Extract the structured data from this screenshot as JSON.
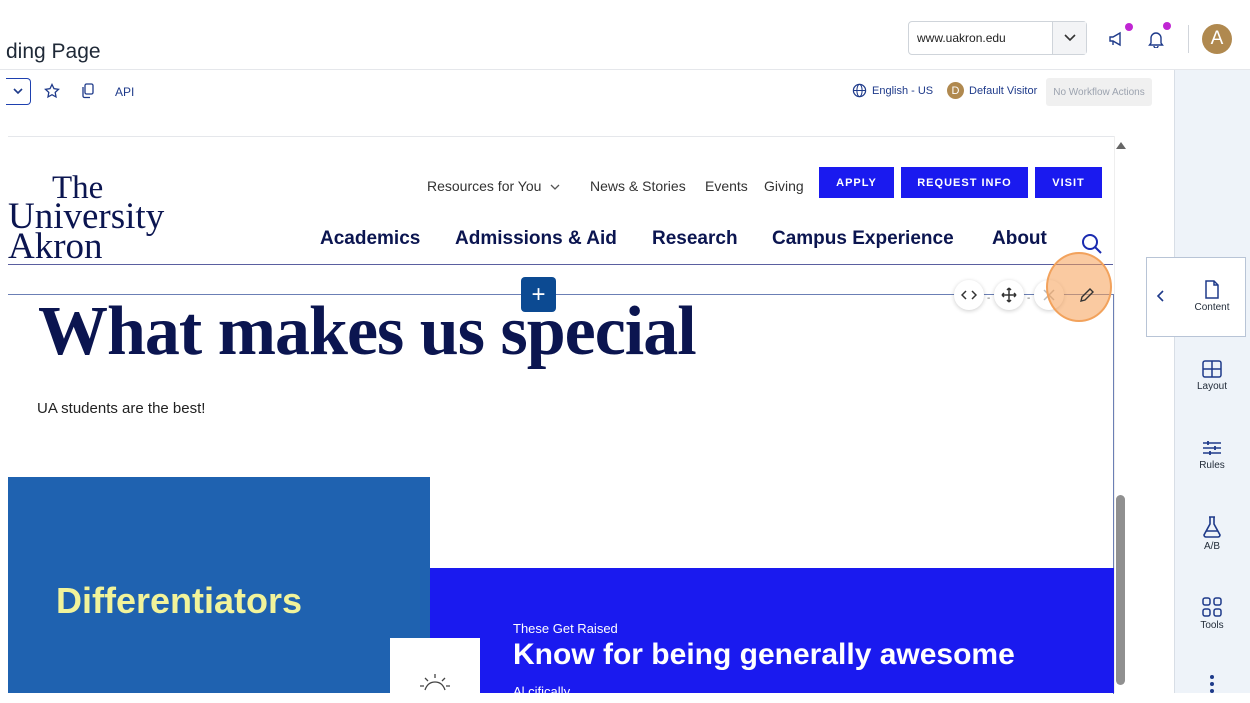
{
  "header": {
    "page_title": "ding Page",
    "domain_select": "www.uakron.edu",
    "avatar_letter": "A"
  },
  "toolbar": {
    "api_label": "API",
    "language": "English - US",
    "visitor_badge": "D",
    "visitor": "Default Visitor",
    "workflow": "No Workflow Actions"
  },
  "site": {
    "logo": {
      "line1": "The",
      "line2": "University",
      "line3": "Akron"
    },
    "utility_nav": [
      "Resources for You",
      "News & Stories",
      "Events",
      "Giving"
    ],
    "cta": [
      "APPLY",
      "REQUEST INFO",
      "VISIT"
    ],
    "main_nav": [
      "Academics",
      "Admissions & Aid",
      "Research",
      "Campus Experience",
      "About"
    ]
  },
  "content": {
    "hero_title": "What makes us special",
    "hero_sub": "UA students are the best!",
    "differentiators": "Differentiators",
    "eyebrow": "These Get Raised",
    "know_title": "Know for being generally awesome",
    "know_sub": "Al    cifically"
  },
  "panel": {
    "content": "Content",
    "layout": "Layout",
    "rules": "Rules",
    "ab": "A/B",
    "tools": "Tools"
  },
  "colors": {
    "brand_navy": "#0b1550",
    "cta_blue": "#1a1aef",
    "diff_blue": "#1f62b0",
    "diff_text": "#f1f39a",
    "highlight": "#f2a25c"
  }
}
